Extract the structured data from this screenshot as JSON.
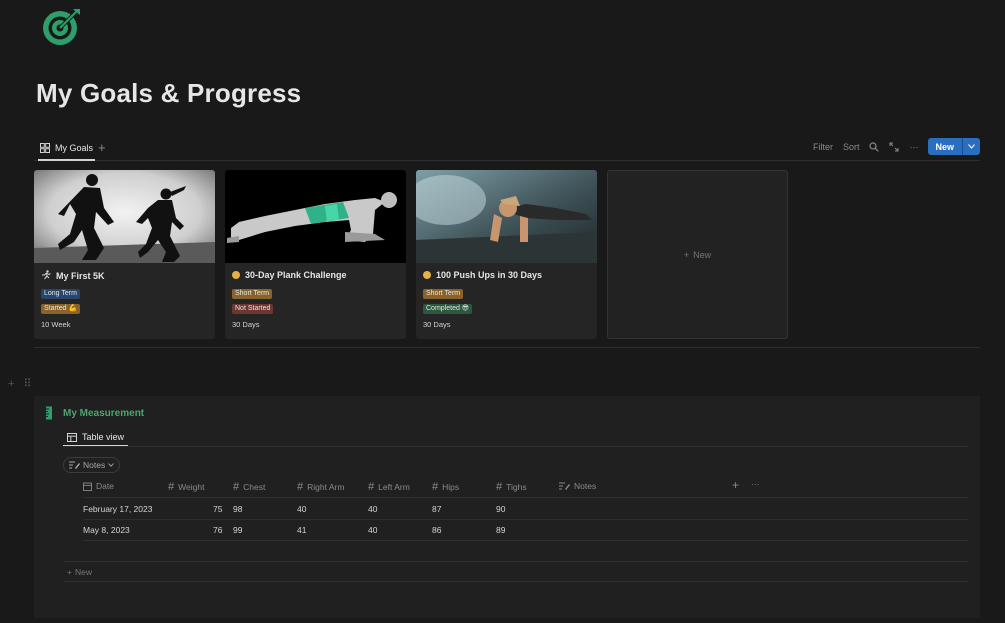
{
  "page": {
    "title": "My Goals & Progress",
    "accent_color": "#2e9e6b"
  },
  "view_tabs": {
    "active_label": "My Goals",
    "add_icon": "plus-icon"
  },
  "toolbar": {
    "filter_label": "Filter",
    "sort_label": "Sort",
    "new_label": "New"
  },
  "goals": [
    {
      "icon": "running-icon",
      "title": "My First 5K",
      "tags": [
        {
          "text": "Long Term",
          "color": "#28456c"
        },
        {
          "text": "Started 💪",
          "color": "#89632a"
        }
      ],
      "duration": "10 Week"
    },
    {
      "icon": "circle-icon",
      "title": "30-Day Plank Challenge",
      "tags": [
        {
          "text": "Short Term",
          "color": "#89632a"
        },
        {
          "text": "Not Started",
          "color": "#6e3630"
        }
      ],
      "duration": "30 Days"
    },
    {
      "icon": "circle-icon",
      "title": "100 Push Ups in 30 Days",
      "tags": [
        {
          "text": "Short Term",
          "color": "#89632a"
        },
        {
          "text": "Completed 😎",
          "color": "#2b593f"
        }
      ],
      "duration": "30 Days"
    }
  ],
  "gallery_new_label": "New",
  "measurement": {
    "title": "My Measurement",
    "view_label": "Table view",
    "filter_pill": "Notes",
    "columns": [
      "Date",
      "Weight",
      "Chest",
      "Right Arm",
      "Left Arm",
      "Hips",
      "Tighs",
      "Notes"
    ],
    "rows": [
      {
        "date": "February 17, 2023",
        "weight": "75",
        "chest": "98",
        "right_arm": "40",
        "left_arm": "40",
        "hips": "87",
        "thighs": "90",
        "notes": ""
      },
      {
        "date": "May 8, 2023",
        "weight": "76",
        "chest": "99",
        "right_arm": "41",
        "left_arm": "40",
        "hips": "86",
        "thighs": "89",
        "notes": ""
      }
    ],
    "new_row_label": "New"
  }
}
